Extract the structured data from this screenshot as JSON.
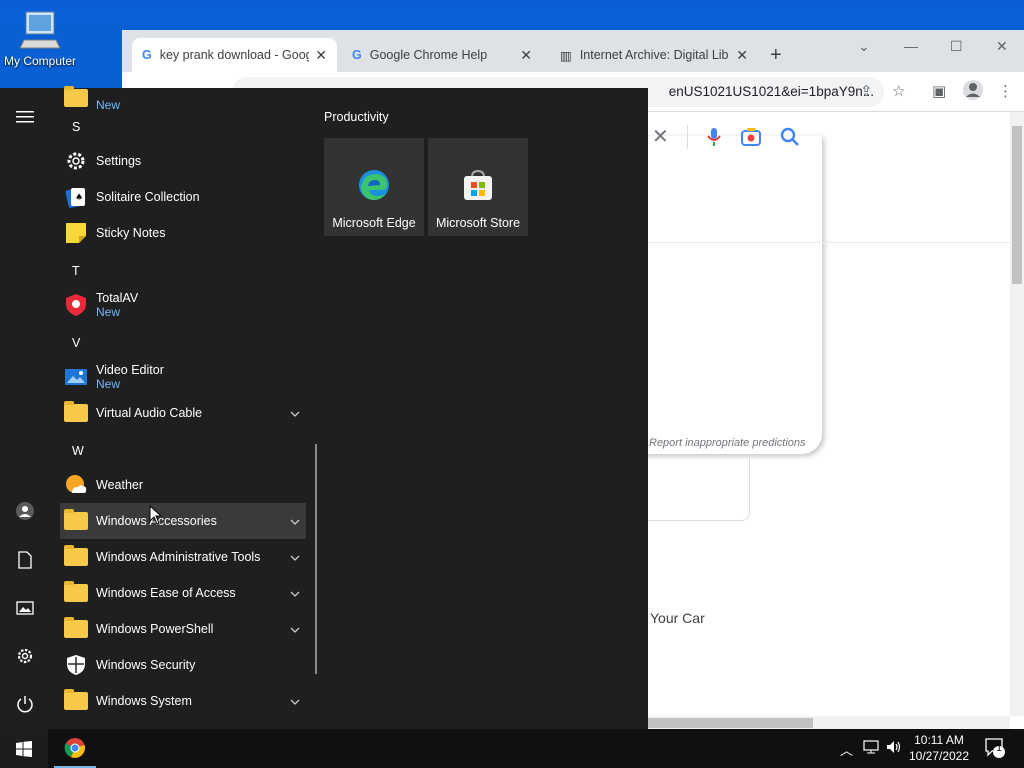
{
  "desktop": {
    "icon_label": "My Computer"
  },
  "chrome": {
    "tabs": [
      {
        "title": "key prank download - Goog",
        "favicon": "google-g-icon"
      },
      {
        "title": "Google Chrome Help",
        "favicon": "google-g-icon"
      },
      {
        "title": "Internet Archive: Digital Lib",
        "favicon": "archive-icon"
      }
    ],
    "url": "enUS1021US1021&ei=1bpaY9n...",
    "report_text": "Report inappropriate predictions",
    "snippet": "Your Car"
  },
  "start_menu": {
    "top_partial_new": "New",
    "letters": {
      "s": "S",
      "t": "T",
      "v": "V",
      "w": "W"
    },
    "apps": {
      "settings": "Settings",
      "solitaire": "Solitaire Collection",
      "sticky": "Sticky Notes",
      "totalav": "TotalAV",
      "totalav_badge": "New",
      "video_editor": "Video Editor",
      "video_editor_badge": "New",
      "virtual_audio": "Virtual Audio Cable",
      "weather": "Weather",
      "win_accessories": "Windows Accessories",
      "win_admin": "Windows Administrative Tools",
      "win_ease": "Windows Ease of Access",
      "win_powershell": "Windows PowerShell",
      "win_security": "Windows Security",
      "win_system": "Windows System"
    },
    "group_title": "Productivity",
    "tiles": [
      {
        "label": "Microsoft Edge",
        "icon": "edge-icon"
      },
      {
        "label": "Microsoft Store",
        "icon": "store-icon"
      }
    ]
  },
  "taskbar": {
    "time": "10:11 AM",
    "date": "10/27/2022",
    "notifications": "1"
  },
  "colors": {
    "start_bg": "#1f1f1f",
    "accent_new": "#6cb8ff",
    "folder": "#f7c948"
  }
}
